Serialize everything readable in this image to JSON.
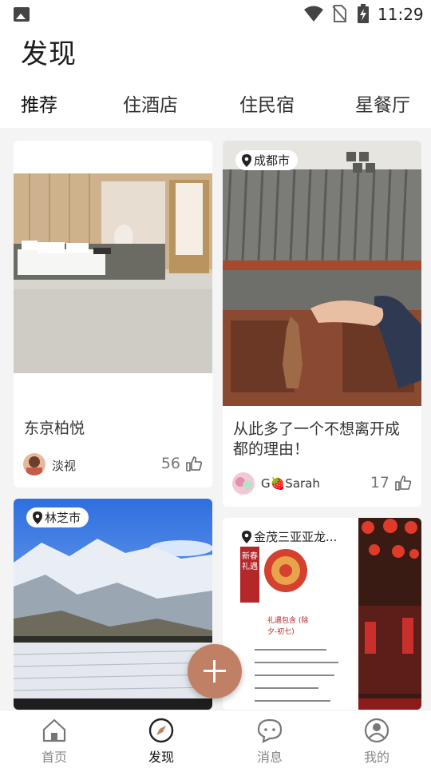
{
  "status_bar": {
    "time": "11:29"
  },
  "header": {
    "title": "发现"
  },
  "tabs": [
    {
      "label": "推荐",
      "active": true
    },
    {
      "label": "住酒店",
      "active": false
    },
    {
      "label": "住民宿",
      "active": false
    },
    {
      "label": "星餐厅",
      "active": false
    }
  ],
  "feed": [
    {
      "title": "东京柏悦",
      "user": "淡视",
      "likes": "56"
    },
    {
      "location": "成都市",
      "title": "从此多了一个不想离开成都的理由！",
      "user": "G🍓Sarah",
      "likes": "17"
    },
    {
      "location": "林芝市"
    },
    {
      "location": "金茂三亚亚龙...",
      "poster_tag": "新春礼遇",
      "poster_title": "礼遇包含 (除夕-初七)"
    }
  ],
  "bottom_nav": [
    {
      "label": "首页",
      "icon": "home-icon",
      "active": false
    },
    {
      "label": "发现",
      "icon": "compass-icon",
      "active": true
    },
    {
      "label": "消息",
      "icon": "message-icon",
      "active": false
    },
    {
      "label": "我的",
      "icon": "profile-icon",
      "active": false
    }
  ],
  "colors": {
    "accent": "#c08066",
    "background": "#f4f4f5",
    "card": "#ffffff"
  }
}
